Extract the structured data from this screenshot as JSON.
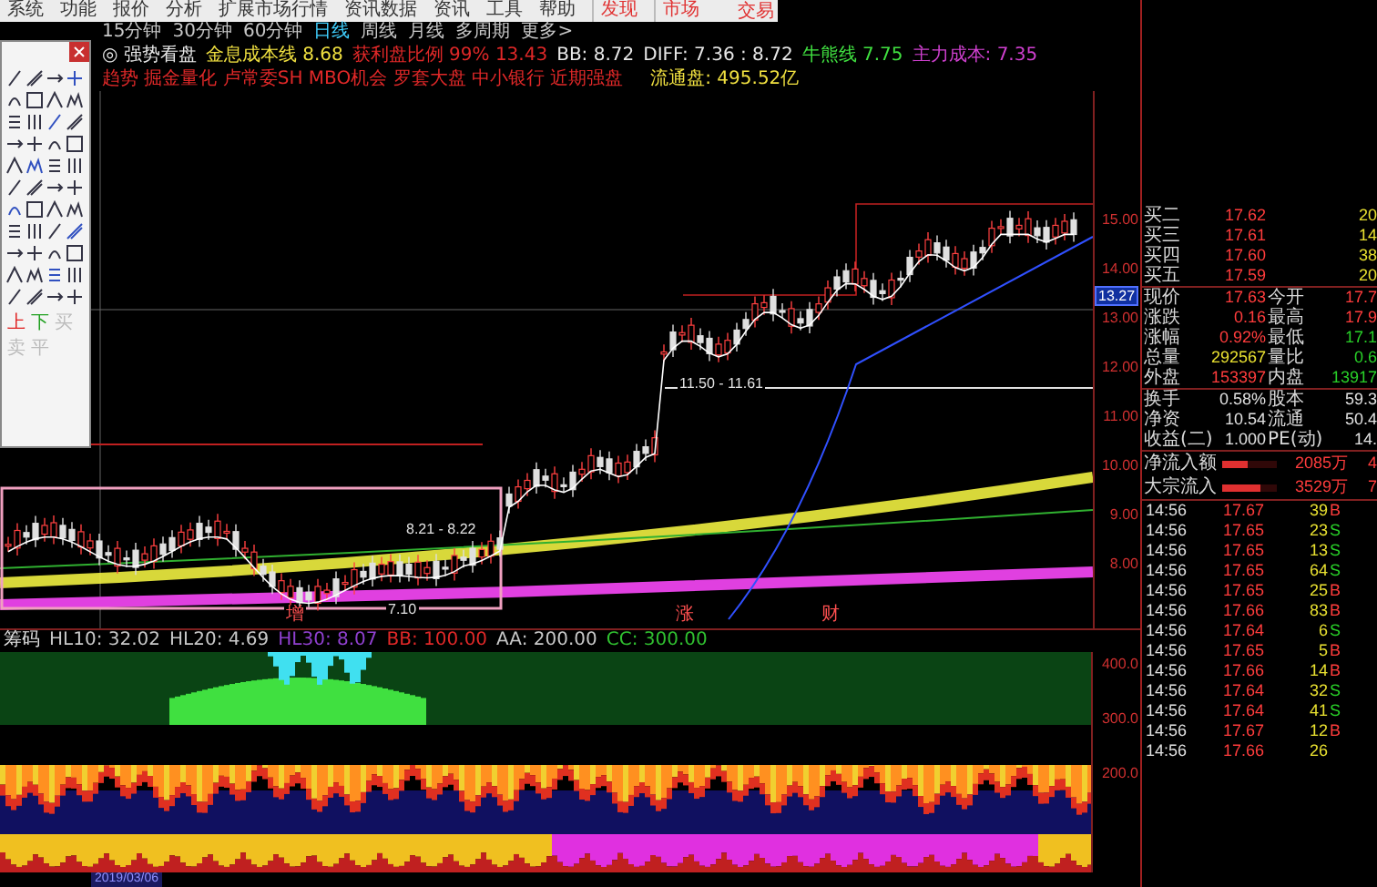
{
  "menu": [
    {
      "label": "系统",
      "highlighted": false
    },
    {
      "label": "功能",
      "highlighted": false
    },
    {
      "label": "报价",
      "highlighted": false
    },
    {
      "label": "分析",
      "highlighted": false
    },
    {
      "label": "扩展市场行情",
      "highlighted": false
    },
    {
      "label": "资讯数据",
      "highlighted": false
    },
    {
      "label": "资讯",
      "highlighted": false
    },
    {
      "label": "工具",
      "highlighted": false
    },
    {
      "label": "帮助",
      "highlighted": false
    },
    {
      "label": "发现",
      "highlighted": true
    },
    {
      "label": "市场",
      "highlighted": true
    }
  ],
  "menu_right": "交易",
  "periods": [
    {
      "label": "15分钟",
      "selected": false
    },
    {
      "label": "30分钟",
      "selected": false
    },
    {
      "label": "60分钟",
      "selected": false
    },
    {
      "label": "日线",
      "selected": true
    },
    {
      "label": "周线",
      "selected": false
    },
    {
      "label": "月线",
      "selected": false
    },
    {
      "label": "多周期",
      "selected": false
    },
    {
      "label": "更多>",
      "selected": false
    }
  ],
  "indicator_line": [
    {
      "text": "◎ 强势看盘",
      "color": "#e8e8e8"
    },
    {
      "text": "金息成本线 8.68",
      "color": "#f0e040"
    },
    {
      "text": "获利盘比例 99% 13.43",
      "color": "#e02828"
    },
    {
      "text": "BB: 8.72",
      "color": "#e8e8e8"
    },
    {
      "text": "DIFF: 7.36 : 8.72",
      "color": "#e8e8e8"
    },
    {
      "text": "牛熊线 7.75",
      "color": "#40e040"
    },
    {
      "text": "主力成本: 7.35",
      "color": "#d040d0"
    }
  ],
  "concepts": "趋势 掘金量化 卢常委SH MBO机会 罗套大盘 中小银行 近期强盘",
  "float_shares": "流通盘: 495.52亿",
  "palette": {
    "text_tools": [
      {
        "label": "上",
        "color": "#e02020",
        "disabled": false
      },
      {
        "label": "下",
        "color": "#20a020",
        "disabled": false
      },
      {
        "label": "买",
        "disabled": true
      },
      {
        "label": "卖",
        "disabled": true
      },
      {
        "label": "平",
        "disabled": true
      }
    ]
  },
  "price_axis": [
    "15.00",
    "14.00",
    "13.00",
    "12.00",
    "11.00",
    "10.00",
    "9.00",
    "8.00"
  ],
  "price_marker": "13.27",
  "chart_labels": [
    {
      "text": "11.50 - 11.61",
      "kind": "range"
    },
    {
      "text": "8.21 - 8.22",
      "kind": "range"
    },
    {
      "text": "增",
      "kind": "event"
    },
    {
      "text": "7.10",
      "kind": "low"
    },
    {
      "text": "涨",
      "kind": "event"
    },
    {
      "text": "财",
      "kind": "event"
    }
  ],
  "indicator_header": [
    {
      "text": "筹码"
    },
    {
      "text": "HL10: 32.02"
    },
    {
      "text": "HL20: 4.69"
    },
    {
      "text": "HL30: 8.07"
    },
    {
      "text": "BB: 100.00"
    },
    {
      "text": "AA: 200.00"
    },
    {
      "text": "CC: 300.00"
    }
  ],
  "indicator_axis": [
    "400.0",
    "300.0",
    "200.0"
  ],
  "date": "2019/03/06",
  "quote": {
    "sections": [
      {
        "rows": [
          {
            "cells": [
              {
                "label": "买二",
                "value": "17.62",
                "color": "#ff3c3c"
              },
              {
                "value": "20",
                "color": "#e8e030"
              }
            ]
          },
          {
            "cells": [
              {
                "label": "买三",
                "value": "17.61",
                "color": "#ff3c3c"
              },
              {
                "value": "14",
                "color": "#e8e030"
              }
            ]
          },
          {
            "cells": [
              {
                "label": "买四",
                "value": "17.60",
                "color": "#ff3c3c"
              },
              {
                "value": "38",
                "color": "#e8e030"
              }
            ]
          },
          {
            "cells": [
              {
                "label": "买五",
                "value": "17.59",
                "color": "#ff3c3c"
              },
              {
                "value": "20",
                "color": "#e8e030"
              }
            ]
          }
        ]
      },
      {
        "rows": [
          {
            "cells": [
              {
                "label": "现价",
                "value": "17.63",
                "color": "#ff3c3c"
              },
              {
                "label": "今开",
                "value": "17.7",
                "color": "#ff3c3c"
              }
            ]
          },
          {
            "cells": [
              {
                "label": "涨跌",
                "value": "0.16",
                "color": "#ff3c3c"
              },
              {
                "label": "最高",
                "value": "17.9",
                "color": "#ff3c3c"
              }
            ]
          },
          {
            "cells": [
              {
                "label": "涨幅",
                "value": "0.92%",
                "color": "#ff3c3c"
              },
              {
                "label": "最低",
                "value": "17.1",
                "color": "#28d028"
              }
            ]
          },
          {
            "cells": [
              {
                "label": "总量",
                "value": "292567",
                "color": "#e8e030"
              },
              {
                "label": "量比",
                "value": "0.6",
                "color": "#28d028"
              }
            ]
          },
          {
            "cells": [
              {
                "label": "外盘",
                "value": "153397",
                "color": "#ff3c3c"
              },
              {
                "label": "内盘",
                "value": "13917",
                "color": "#28d028"
              }
            ]
          }
        ]
      },
      {
        "rows": [
          {
            "cells": [
              {
                "label": "换手",
                "value": "0.58%",
                "color": "#e0e0e0"
              },
              {
                "label": "股本",
                "value": "59.3",
                "color": "#e0e0e0"
              }
            ]
          },
          {
            "cells": [
              {
                "label": "净资",
                "value": "10.54",
                "color": "#e0e0e0"
              },
              {
                "label": "流通",
                "value": "50.4",
                "color": "#e0e0e0"
              }
            ]
          },
          {
            "cells": [
              {
                "label": "收益(二)",
                "value": "1.000",
                "color": "#e0e0e0"
              },
              {
                "label": "PE(动)",
                "value": "14.",
                "color": "#e0e0e0"
              }
            ]
          }
        ]
      }
    ],
    "flows": [
      {
        "label": "净流入额",
        "level": 0.45,
        "value": "2085万",
        "extra": "4"
      },
      {
        "label": "大宗流入",
        "level": 0.7,
        "value": "3529万",
        "extra": "7"
      }
    ],
    "ticks": [
      {
        "time": "14:56",
        "price": "17.67",
        "volume": "39",
        "side": "B",
        "kind": "buy"
      },
      {
        "time": "14:56",
        "price": "17.65",
        "volume": "23",
        "side": "S",
        "kind": "sell"
      },
      {
        "time": "14:56",
        "price": "17.65",
        "volume": "13",
        "side": "S",
        "kind": "sell"
      },
      {
        "time": "14:56",
        "price": "17.65",
        "volume": "64",
        "side": "S",
        "kind": "sell"
      },
      {
        "time": "14:56",
        "price": "17.65",
        "volume": "25",
        "side": "B",
        "kind": "buy"
      },
      {
        "time": "14:56",
        "price": "17.66",
        "volume": "83",
        "side": "B",
        "kind": "buy"
      },
      {
        "time": "14:56",
        "price": "17.64",
        "volume": "6",
        "side": "S",
        "kind": "sell"
      },
      {
        "time": "14:56",
        "price": "17.65",
        "volume": "5",
        "side": "B",
        "kind": "buy"
      },
      {
        "time": "14:56",
        "price": "17.66",
        "volume": "14",
        "side": "B",
        "kind": "buy"
      },
      {
        "time": "14:56",
        "price": "17.64",
        "volume": "32",
        "side": "S",
        "kind": "sell"
      },
      {
        "time": "14:56",
        "price": "17.64",
        "volume": "41",
        "side": "S",
        "kind": "sell"
      },
      {
        "time": "14:56",
        "price": "17.67",
        "volume": "12",
        "side": "B",
        "kind": "buy"
      },
      {
        "time": "14:56",
        "price": "17.66",
        "volume": "26",
        "kind": "none"
      }
    ]
  }
}
